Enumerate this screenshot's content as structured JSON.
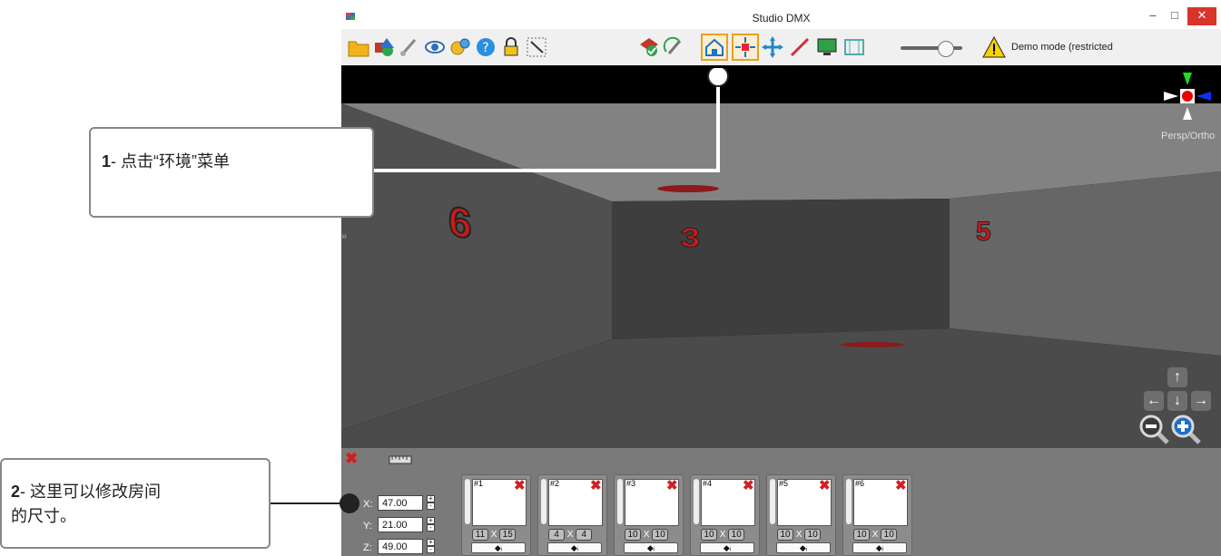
{
  "window": {
    "title": "Studio DMX",
    "minimize": "–",
    "maximize": "□",
    "close": "✕"
  },
  "toolbar": {
    "icons": [
      "folder-icon",
      "objects-icon",
      "brush-icon",
      "eye-icon",
      "settings-icon",
      "help-icon",
      "lock-icon",
      "cursor-icon",
      "check-icon",
      "rotate-icon",
      "environment-icon",
      "fixtures-icon",
      "move-icon",
      "beam-icon",
      "monitor-icon",
      "film-icon"
    ],
    "selected": [
      "environment-icon",
      "fixtures-icon"
    ],
    "demo_text": "Demo mode (restricted"
  },
  "viewport": {
    "persp_label": "Persp/Ortho",
    "wall_numbers": [
      "6",
      "3",
      "5"
    ],
    "nav": {
      "up": "↑",
      "left": "←",
      "down": "↓",
      "right": "→"
    }
  },
  "dimensions": {
    "x_label": "X:",
    "x_value": "47.00",
    "y_label": "Y:",
    "y_value": "21.00",
    "z_label": "Z:",
    "z_value": "49.00",
    "plus": "+",
    "minus": "-"
  },
  "walls": [
    {
      "label": "#1",
      "w": "11",
      "h": "15"
    },
    {
      "label": "#2",
      "w": "4",
      "h": "4"
    },
    {
      "label": "#3",
      "w": "10",
      "h": "10"
    },
    {
      "label": "#4",
      "w": "10",
      "h": "10"
    },
    {
      "label": "#5",
      "w": "10",
      "h": "10"
    },
    {
      "label": "#6",
      "w": "10",
      "h": "10"
    }
  ],
  "wall_x": "X",
  "callouts": {
    "c1_num": "1",
    "c1_text": "- 点击“环境”菜单",
    "c2_num": "2",
    "c2_text_line1": "- 这里可以修改房间",
    "c2_text_line2": "的尺寸。"
  },
  "colors": {
    "accent": "#e8a020",
    "close": "#d9342b",
    "delete": "#d21f1f"
  }
}
